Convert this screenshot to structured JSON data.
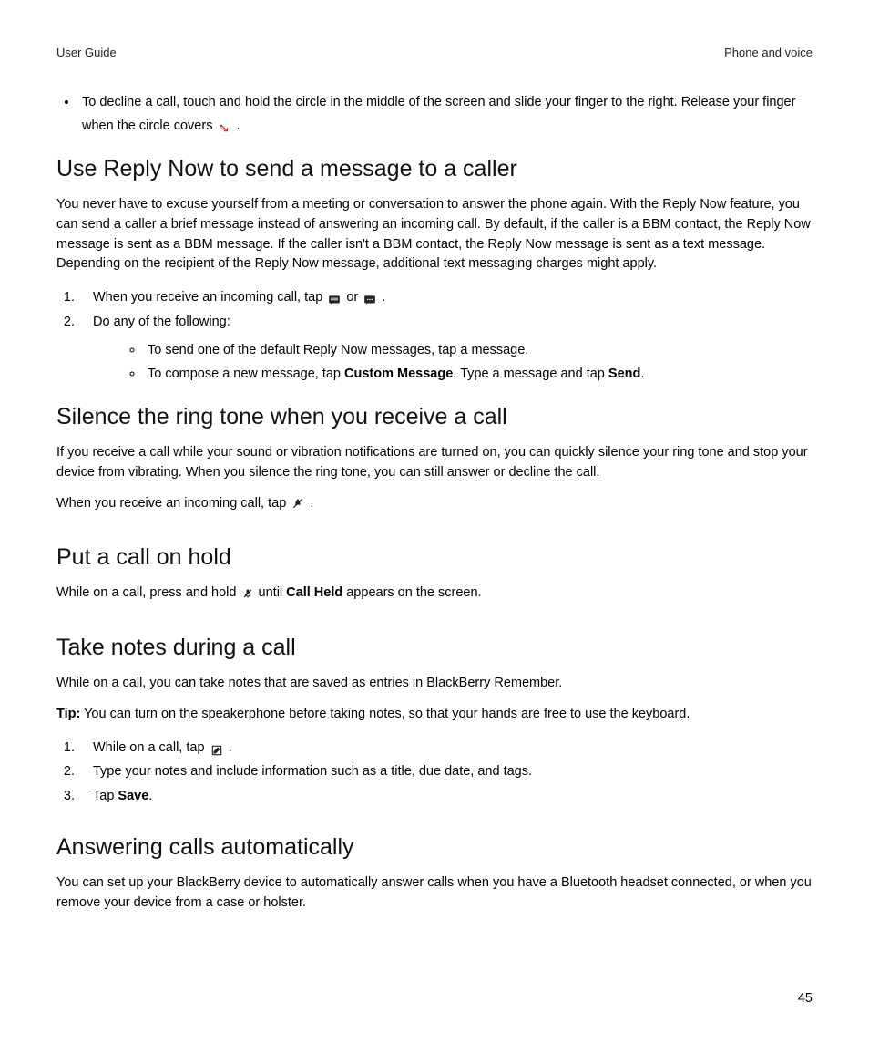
{
  "header": {
    "left": "User Guide",
    "right": "Phone and voice"
  },
  "bullet_intro": {
    "pre": "To decline a call, touch and hold the circle in the middle of the screen and slide your finger to the right. Release your finger when the circle covers ",
    "post": "."
  },
  "s1": {
    "title": "Use Reply Now to send a message to a caller",
    "para": "You never have to excuse yourself from a meeting or conversation to answer the phone again. With the Reply Now feature, you can send a caller a brief message instead of answering an incoming call. By default, if the caller is a BBM contact, the Reply Now message is sent as a BBM message. If the caller isn't a BBM contact, the Reply Now message is sent as a text message. Depending on the recipient of the Reply Now message, additional text messaging charges might apply.",
    "step1_pre": "When you receive an incoming call, tap ",
    "step1_mid": " or ",
    "step1_post": ".",
    "step2": "Do any of the following:",
    "sub1": "To send one of the default Reply Now messages, tap a message.",
    "sub2_pre": "To compose a new message, tap ",
    "sub2_bold1": "Custom Message",
    "sub2_mid": ". Type a message and tap ",
    "sub2_bold2": "Send",
    "sub2_post": "."
  },
  "s2": {
    "title": "Silence the ring tone when you receive a call",
    "para": "If you receive a call while your sound or vibration notifications are turned on, you can quickly silence your ring tone and stop your device from vibrating. When you silence the ring tone, you can still answer or decline the call.",
    "line_pre": "When you receive an incoming call, tap ",
    "line_post": "."
  },
  "s3": {
    "title": "Put a call on hold",
    "line_pre": "While on a call, press and hold ",
    "line_mid": " until ",
    "line_bold": "Call Held",
    "line_post": " appears on the screen."
  },
  "s4": {
    "title": "Take notes during a call",
    "para": "While on a call, you can take notes that are saved as entries in BlackBerry Remember.",
    "tip_label": "Tip:",
    "tip_text": " You can turn on the speakerphone before taking notes, so that your hands are free to use the keyboard.",
    "step1_pre": "While on a call, tap ",
    "step1_post": ".",
    "step2": "Type your notes and include information such as a title, due date, and tags.",
    "step3_pre": "Tap ",
    "step3_bold": "Save",
    "step3_post": "."
  },
  "s5": {
    "title": "Answering calls automatically",
    "para": "You can set up your BlackBerry device to automatically answer calls when you have a Bluetooth headset connected, or when you remove your device from a case or holster."
  },
  "page_number": "45"
}
